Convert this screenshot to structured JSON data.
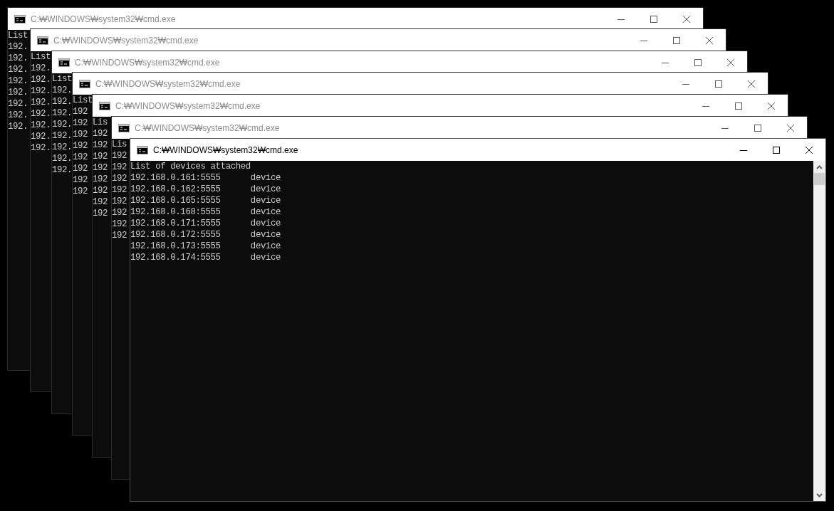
{
  "windows": [
    {
      "title": "C:₩WINDOWS₩system32₩cmd.exe",
      "active": false,
      "lines": [
        "List",
        "192.",
        "192.",
        "192.",
        "192.",
        "192.",
        "192.",
        "192.",
        "192."
      ]
    },
    {
      "title": "C:₩WINDOWS₩system32₩cmd.exe",
      "active": false,
      "lines": [
        "List",
        "192.",
        "192.",
        "192.",
        "192.",
        "192.",
        "192.",
        "192.",
        "192."
      ]
    },
    {
      "title": "C:₩WINDOWS₩system32₩cmd.exe",
      "active": false,
      "lines": [
        "List",
        "192.",
        "192.",
        "192.",
        "192.",
        "192.",
        "192.",
        "192.",
        "192."
      ]
    },
    {
      "title": "C:₩WINDOWS₩system32₩cmd.exe",
      "active": false,
      "lines": [
        "List",
        "192",
        "192",
        "192",
        "192",
        "192",
        "192",
        "192",
        "192"
      ]
    },
    {
      "title": "C:₩WINDOWS₩system32₩cmd.exe",
      "active": false,
      "lines": [
        "Lis",
        "192",
        "192",
        "192",
        "192",
        "192",
        "192",
        "192",
        "192"
      ]
    },
    {
      "title": "C:₩WINDOWS₩system32₩cmd.exe",
      "active": false,
      "lines": [
        "Lis",
        "192",
        "192",
        "192",
        "192",
        "192",
        "192",
        "192",
        "192"
      ]
    },
    {
      "title": "C:₩WINDOWS₩system32₩cmd.exe",
      "active": true,
      "lines": [
        "List of devices attached",
        "192.168.0.161:5555      device",
        "192.168.0.162:5555      device",
        "192.168.0.165:5555      device",
        "192.168.0.168:5555      device",
        "192.168.0.171:5555      device",
        "192.168.0.172:5555      device",
        "192.168.0.173:5555      device",
        "192.168.0.174:5555      device"
      ]
    }
  ]
}
